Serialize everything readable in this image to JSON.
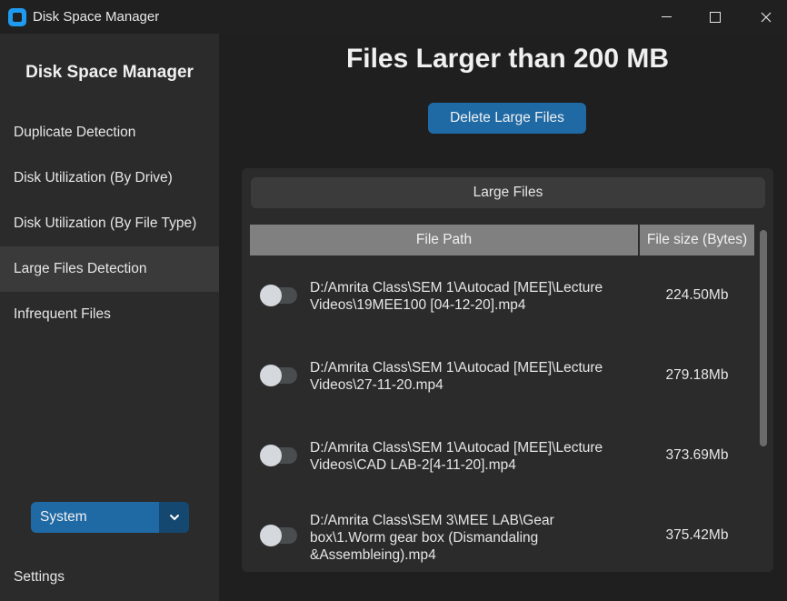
{
  "window": {
    "title": "Disk Space Manager",
    "icons": {
      "app": "app-icon",
      "minimize": "minimize-icon",
      "maximize": "maximize-icon",
      "close": "close-icon"
    }
  },
  "sidebar": {
    "title": "Disk Space Manager",
    "items": [
      {
        "label": "Duplicate Detection",
        "active": false
      },
      {
        "label": "Disk Utilization (By Drive)",
        "active": false
      },
      {
        "label": "Disk Utilization (By File Type)",
        "active": false
      },
      {
        "label": "Large Files Detection",
        "active": true
      },
      {
        "label": "Infrequent Files",
        "active": false
      }
    ],
    "appearance_select": {
      "value": "System",
      "icon": "chevron-down-icon"
    },
    "settings_label": "Settings"
  },
  "main": {
    "title": "Files Larger than 200 MB",
    "delete_button": "Delete Large Files",
    "panel": {
      "header": "Large Files",
      "columns": [
        "File Path",
        "File size (Bytes)"
      ],
      "rows": [
        {
          "path": "D:/Amrita Class\\SEM 1\\Autocad [MEE]\\Lecture Videos\\19MEE100 [04-12-20].mp4",
          "size": "224.50Mb",
          "selected": false
        },
        {
          "path": "D:/Amrita Class\\SEM 1\\Autocad [MEE]\\Lecture Videos\\27-11-20.mp4",
          "size": "279.18Mb",
          "selected": false
        },
        {
          "path": "D:/Amrita Class\\SEM 1\\Autocad [MEE]\\Lecture Videos\\CAD LAB-2[4-11-20].mp4",
          "size": "373.69Mb",
          "selected": false
        },
        {
          "path": "D:/Amrita Class\\SEM 3\\MEE LAB\\Gear box\\1.Worm gear box (Dismandaling &Assembleing).mp4",
          "size": "375.42Mb",
          "selected": false
        }
      ]
    }
  },
  "colors": {
    "accent": "#1f6aa5",
    "sidebar_bg": "#2b2b2b",
    "window_bg": "#1f1f1f"
  }
}
